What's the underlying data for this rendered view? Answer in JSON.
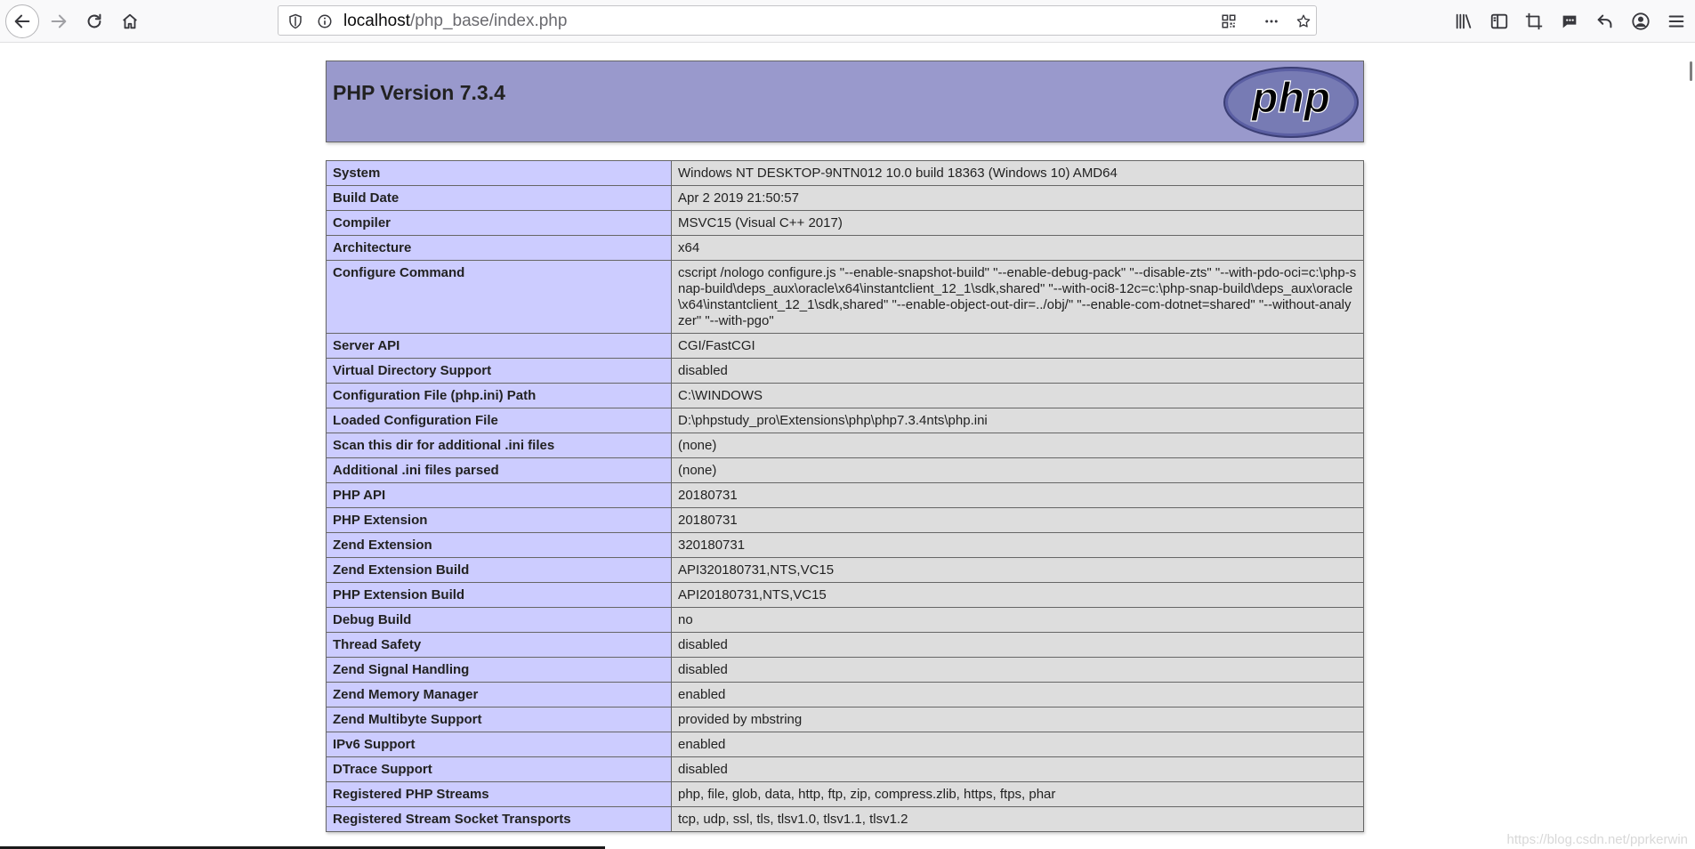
{
  "browser": {
    "url_host": "localhost",
    "url_path": "/php_base/index.php",
    "icons": [
      "back-arrow-icon",
      "forward-arrow-icon",
      "reload-icon",
      "home-icon",
      "shield-icon",
      "info-icon",
      "qr-code-icon",
      "more-icon",
      "star-icon",
      "library-icon",
      "sidebar-icon",
      "crop-icon",
      "chat-icon",
      "undo-icon",
      "account-icon",
      "menu-icon"
    ]
  },
  "header": {
    "title": "PHP Version 7.3.4",
    "logo_text": "php"
  },
  "rows": [
    {
      "label": "System",
      "value": "Windows NT DESKTOP-9NTN012 10.0 build 18363 (Windows 10) AMD64"
    },
    {
      "label": "Build Date",
      "value": "Apr 2 2019 21:50:57"
    },
    {
      "label": "Compiler",
      "value": "MSVC15 (Visual C++ 2017)"
    },
    {
      "label": "Architecture",
      "value": "x64"
    },
    {
      "label": "Configure Command",
      "value": "cscript /nologo configure.js \"--enable-snapshot-build\" \"--enable-debug-pack\" \"--disable-zts\" \"--with-pdo-oci=c:\\php-snap-build\\deps_aux\\oracle\\x64\\instantclient_12_1\\sdk,shared\" \"--with-oci8-12c=c:\\php-snap-build\\deps_aux\\oracle\\x64\\instantclient_12_1\\sdk,shared\" \"--enable-object-out-dir=../obj/\" \"--enable-com-dotnet=shared\" \"--without-analyzer\" \"--with-pgo\""
    },
    {
      "label": "Server API",
      "value": "CGI/FastCGI"
    },
    {
      "label": "Virtual Directory Support",
      "value": "disabled"
    },
    {
      "label": "Configuration File (php.ini) Path",
      "value": "C:\\WINDOWS"
    },
    {
      "label": "Loaded Configuration File",
      "value": "D:\\phpstudy_pro\\Extensions\\php\\php7.3.4nts\\php.ini"
    },
    {
      "label": "Scan this dir for additional .ini files",
      "value": "(none)"
    },
    {
      "label": "Additional .ini files parsed",
      "value": "(none)"
    },
    {
      "label": "PHP API",
      "value": "20180731"
    },
    {
      "label": "PHP Extension",
      "value": "20180731"
    },
    {
      "label": "Zend Extension",
      "value": "320180731"
    },
    {
      "label": "Zend Extension Build",
      "value": "API320180731,NTS,VC15"
    },
    {
      "label": "PHP Extension Build",
      "value": "API20180731,NTS,VC15"
    },
    {
      "label": "Debug Build",
      "value": "no"
    },
    {
      "label": "Thread Safety",
      "value": "disabled"
    },
    {
      "label": "Zend Signal Handling",
      "value": "disabled"
    },
    {
      "label": "Zend Memory Manager",
      "value": "enabled"
    },
    {
      "label": "Zend Multibyte Support",
      "value": "provided by mbstring"
    },
    {
      "label": "IPv6 Support",
      "value": "enabled"
    },
    {
      "label": "DTrace Support",
      "value": "disabled"
    },
    {
      "label": "Registered PHP Streams",
      "value": "php, file, glob, data, http, ftp, zip, compress.zlib, https, ftps, phar"
    },
    {
      "label": "Registered Stream Socket Transports",
      "value": "tcp, udp, ssl, tls, tlsv1.0, tlsv1.1, tlsv1.2"
    }
  ],
  "watermark": "https://blog.csdn.net/pprkerwin",
  "colors": {
    "header_bg": "#9999cc",
    "label_bg": "#ccccff",
    "value_bg": "#dddddd",
    "border": "#666666"
  }
}
